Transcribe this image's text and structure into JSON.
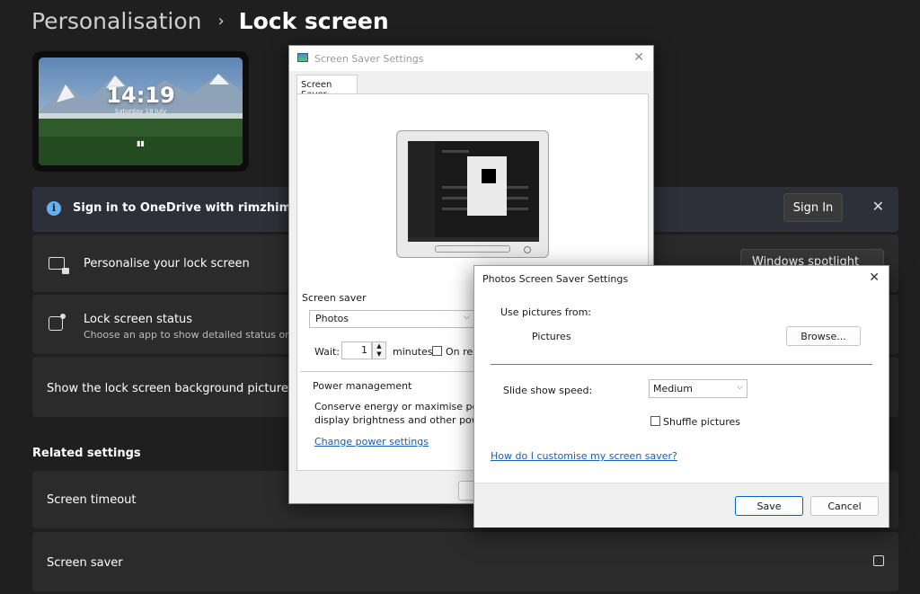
{
  "breadcrumb": {
    "parent": "Personalisation",
    "separator": "›",
    "current": "Lock screen"
  },
  "lock_preview": {
    "time": "14:19",
    "date": "Saturday 18 July"
  },
  "onedrive_banner": {
    "text": "Sign in to OneDrive with rimzhims to a",
    "button_label": "Sign In",
    "close_glyph": "✕"
  },
  "rows": {
    "personalise": {
      "title": "Personalise your lock screen",
      "dropdown_value": "Windows spotlight"
    },
    "status": {
      "title": "Lock screen status",
      "subtitle": "Choose an app to show detailed status on t"
    },
    "background": {
      "title": "Show the lock screen background picture on"
    }
  },
  "related": {
    "heading": "Related settings",
    "screen_timeout": "Screen timeout",
    "screen_saver": "Screen saver"
  },
  "screen_saver_dialog": {
    "title": "Screen Saver Settings",
    "close_glyph": "✕",
    "tab": "Screen Saver",
    "group_label": "Screen saver",
    "selected_saver": "Photos",
    "wait_label": "Wait:",
    "wait_value": "1",
    "minutes_label": "minutes",
    "resume_label": "On res",
    "power_label": "Power management",
    "power_text_1": "Conserve energy or maximise perfo",
    "power_text_2": "display brightness and other powe",
    "power_link": "Change power settings"
  },
  "photos_dialog": {
    "title": "Photos Screen Saver Settings",
    "close_glyph": "✕",
    "use_pictures_label": "Use pictures from:",
    "pictures_folder": "Pictures",
    "browse_label": "Browse...",
    "speed_label": "Slide show speed:",
    "speed_value": "Medium",
    "shuffle_label": "Shuffle pictures",
    "help_link": "How do I customise my screen saver?",
    "save_label": "Save",
    "cancel_label": "Cancel"
  },
  "colors": {
    "background": "#1f1f1f",
    "row": "#2b2b2b",
    "info_banner": "#2d3038",
    "accent_info": "#63b1f0",
    "link": "#1a5fb4"
  }
}
